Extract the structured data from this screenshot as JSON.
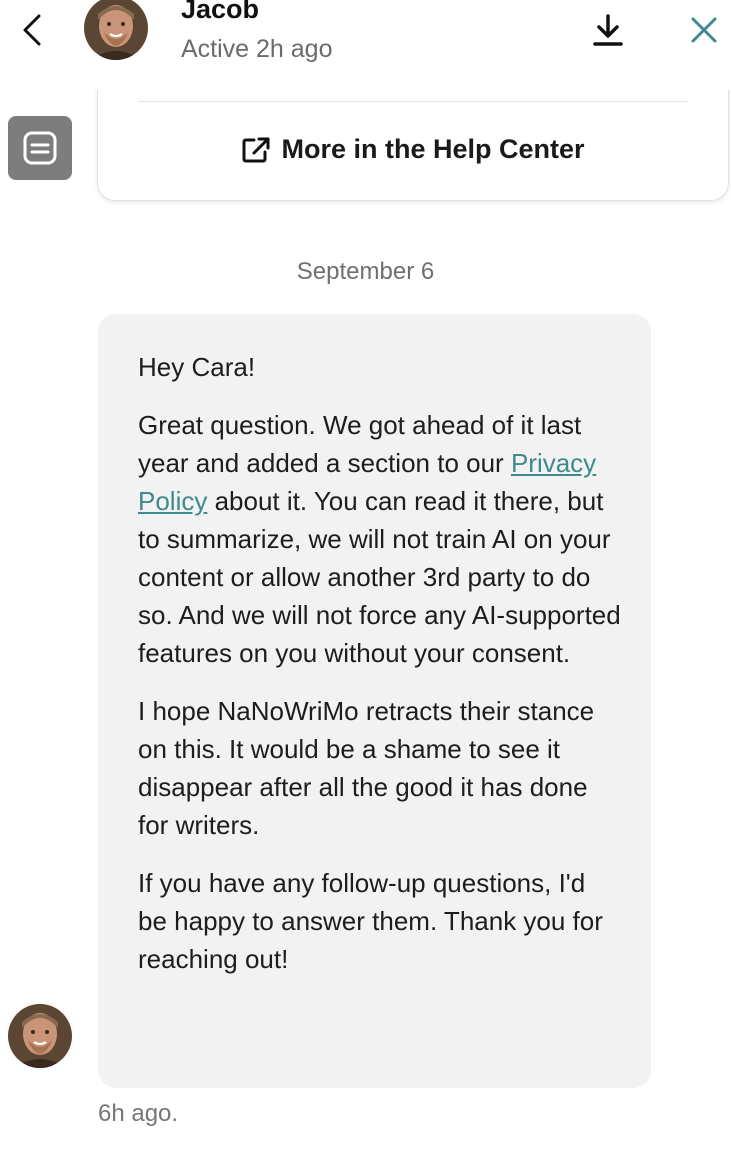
{
  "header": {
    "name": "Jacob",
    "status": "Active 2h ago",
    "back_icon": "chevron-left-icon",
    "download_icon": "download-icon",
    "close_icon": "close-icon",
    "close_color": "#3f8a8c"
  },
  "help_card": {
    "link_label": "More in the Help Center",
    "link_icon": "external-link-icon",
    "bot_icon": "bot-icon"
  },
  "date_separator": "September 6",
  "message": {
    "greeting": "Hey Cara!",
    "p1_before": "Great question. We got ahead of it last year and added a section to our ",
    "p1_link": "Privacy Policy",
    "p1_after": " about it. You can read it there, but to summarize, we will not train AI on your content or allow another 3rd party to do so. And we will not force any AI-supported features on you without your consent.",
    "p2": "I hope NaNoWriMo retracts their stance on this. It would be a shame to see it disappear after all the good it has done for writers.",
    "p3": "If you have any follow-up questions, I'd be happy to answer them. Thank you for reaching out!",
    "time": "6h ago.",
    "link_color": "#3f8a8c"
  }
}
